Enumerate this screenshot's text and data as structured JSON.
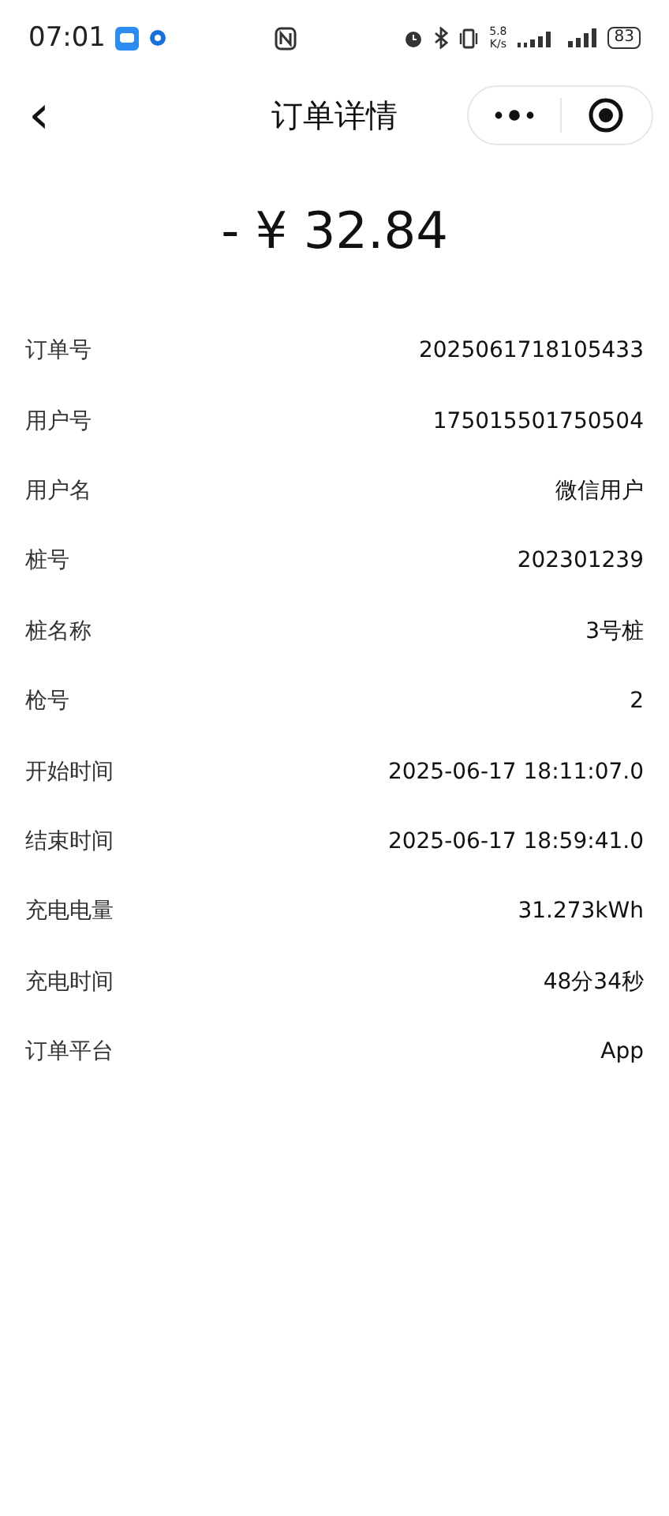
{
  "status_bar": {
    "time": "07:01",
    "speed_value": "5.8",
    "speed_unit": "K/s",
    "battery": "83"
  },
  "nav": {
    "back": "‹",
    "title": "订单详情"
  },
  "amount": "- ¥ 32.84",
  "rows": [
    {
      "label": "订单号",
      "value": "2025061718105433"
    },
    {
      "label": "用户号",
      "value": "175015501750504"
    },
    {
      "label": "用户名",
      "value": "微信用户"
    },
    {
      "label": "桩号",
      "value": "202301239"
    },
    {
      "label": "桩名称",
      "value": "3号桩"
    },
    {
      "label": "枪号",
      "value": "2"
    },
    {
      "label": "开始时间",
      "value": "2025-06-17 18:11:07.0"
    },
    {
      "label": "结束时间",
      "value": "2025-06-17 18:59:41.0"
    },
    {
      "label": "充电电量",
      "value": "31.273kWh"
    },
    {
      "label": "充电时间",
      "value": "48分34秒"
    },
    {
      "label": "订单平台",
      "value": "App"
    }
  ]
}
